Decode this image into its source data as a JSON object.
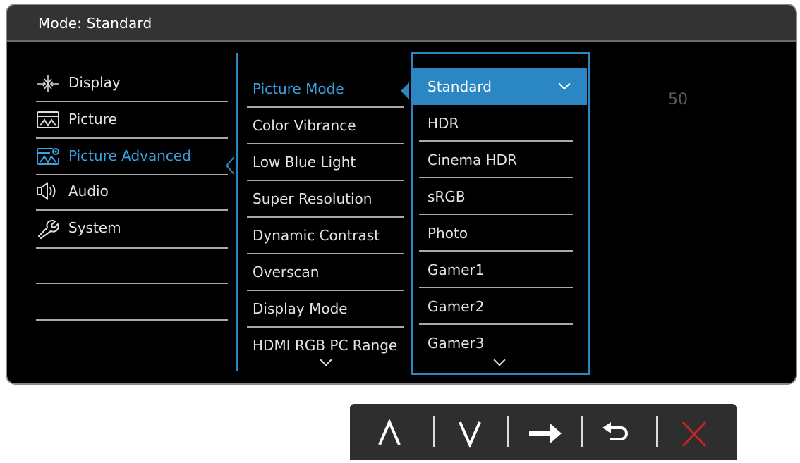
{
  "header": {
    "title": "Mode: Standard"
  },
  "main_menu": {
    "items": [
      {
        "label": "Display",
        "icon": "display-icon"
      },
      {
        "label": "Picture",
        "icon": "picture-icon"
      },
      {
        "label": "Picture Advanced",
        "icon": "picture-advanced-icon",
        "selected": true
      },
      {
        "label": "Audio",
        "icon": "audio-icon"
      },
      {
        "label": "System",
        "icon": "system-icon"
      },
      {
        "label": ""
      },
      {
        "label": ""
      }
    ]
  },
  "sub_menu": {
    "items": [
      {
        "label": "Picture Mode",
        "selected": true
      },
      {
        "label": "Color Vibrance"
      },
      {
        "label": "Low Blue Light"
      },
      {
        "label": "Super Resolution"
      },
      {
        "label": "Dynamic Contrast"
      },
      {
        "label": "Overscan"
      },
      {
        "label": "Display Mode"
      },
      {
        "label": "HDMI RGB PC Range"
      }
    ]
  },
  "options": {
    "items": [
      {
        "label": "Standard",
        "selected": true,
        "checked": true
      },
      {
        "label": "HDR"
      },
      {
        "label": "Cinema HDR"
      },
      {
        "label": "sRGB"
      },
      {
        "label": "Photo"
      },
      {
        "label": "Gamer1"
      },
      {
        "label": "Gamer2"
      },
      {
        "label": "Gamer3"
      }
    ]
  },
  "value_display": "50",
  "control_keys": [
    {
      "name": "up-key",
      "icon": "up-icon"
    },
    {
      "name": "down-key",
      "icon": "down-icon"
    },
    {
      "name": "enter-key",
      "icon": "arrow-right-icon"
    },
    {
      "name": "back-key",
      "icon": "back-icon"
    },
    {
      "name": "exit-key",
      "icon": "close-icon"
    }
  ],
  "colors": {
    "accent": "#2a87c4",
    "highlight_text": "#3aa0e0",
    "exit_red": "#c8232b"
  }
}
